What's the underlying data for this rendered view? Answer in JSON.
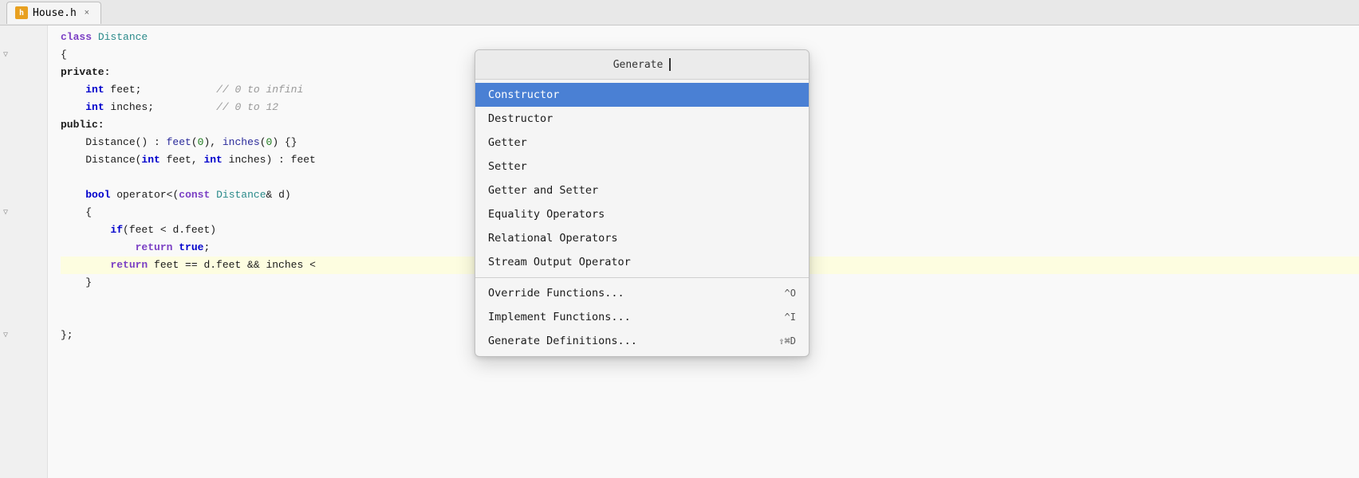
{
  "tab": {
    "filename": "House.h",
    "icon_label": "h",
    "close_label": "×"
  },
  "dropdown": {
    "header": "Generate",
    "cursor_visible": true,
    "items": [
      {
        "id": "constructor",
        "label": "Constructor",
        "shortcut": "",
        "selected": true,
        "separator_after": false
      },
      {
        "id": "destructor",
        "label": "Destructor",
        "shortcut": "",
        "selected": false,
        "separator_after": false
      },
      {
        "id": "getter",
        "label": "Getter",
        "shortcut": "",
        "selected": false,
        "separator_after": false
      },
      {
        "id": "setter",
        "label": "Setter",
        "shortcut": "",
        "selected": false,
        "separator_after": false
      },
      {
        "id": "getter-and-setter",
        "label": "Getter and Setter",
        "shortcut": "",
        "selected": false,
        "separator_after": false
      },
      {
        "id": "equality-operators",
        "label": "Equality Operators",
        "shortcut": "",
        "selected": false,
        "separator_after": false
      },
      {
        "id": "relational-operators",
        "label": "Relational Operators",
        "shortcut": "",
        "selected": false,
        "separator_after": false
      },
      {
        "id": "stream-output-operator",
        "label": "Stream Output Operator",
        "shortcut": "",
        "selected": false,
        "separator_after": true
      },
      {
        "id": "override-functions",
        "label": "Override Functions...",
        "shortcut": "^O",
        "selected": false,
        "separator_after": false
      },
      {
        "id": "implement-functions",
        "label": "Implement Functions...",
        "shortcut": "^I",
        "selected": false,
        "separator_after": false
      },
      {
        "id": "generate-definitions",
        "label": "Generate Definitions...",
        "shortcut": "⇧⌘D",
        "selected": false,
        "separator_after": false
      }
    ]
  },
  "code_lines": [
    {
      "id": 1,
      "content": "class Distance",
      "has_fold": false,
      "highlighted": false
    },
    {
      "id": 2,
      "content": "{",
      "has_fold": true,
      "highlighted": false
    },
    {
      "id": 3,
      "content": "private:",
      "has_fold": false,
      "highlighted": false
    },
    {
      "id": 4,
      "content": "    int feet;            // 0 to infini",
      "has_fold": false,
      "highlighted": false
    },
    {
      "id": 5,
      "content": "    int inches;          // 0 to 12",
      "has_fold": false,
      "highlighted": false
    },
    {
      "id": 6,
      "content": "public:",
      "has_fold": false,
      "highlighted": false
    },
    {
      "id": 7,
      "content": "    Distance() : feet(0), inches(0) {}",
      "has_fold": false,
      "highlighted": false
    },
    {
      "id": 8,
      "content": "    Distance(int feet, int inches) : feet",
      "has_fold": false,
      "highlighted": false
    },
    {
      "id": 9,
      "content": "",
      "has_fold": false,
      "highlighted": false
    },
    {
      "id": 10,
      "content": "    bool operator<(const Distance& d)",
      "has_fold": false,
      "highlighted": false
    },
    {
      "id": 11,
      "content": "    {",
      "has_fold": true,
      "highlighted": false
    },
    {
      "id": 12,
      "content": "        if(feet < d.feet)",
      "has_fold": false,
      "highlighted": false
    },
    {
      "id": 13,
      "content": "            return true;",
      "has_fold": false,
      "highlighted": false
    },
    {
      "id": 14,
      "content": "        return feet == d.feet && inches <",
      "has_fold": false,
      "highlighted": true
    },
    {
      "id": 15,
      "content": "    }",
      "has_fold": false,
      "highlighted": false
    },
    {
      "id": 16,
      "content": "",
      "has_fold": false,
      "highlighted": false
    },
    {
      "id": 17,
      "content": "",
      "has_fold": false,
      "highlighted": false
    },
    {
      "id": 18,
      "content": "};",
      "has_fold": true,
      "highlighted": false
    }
  ]
}
